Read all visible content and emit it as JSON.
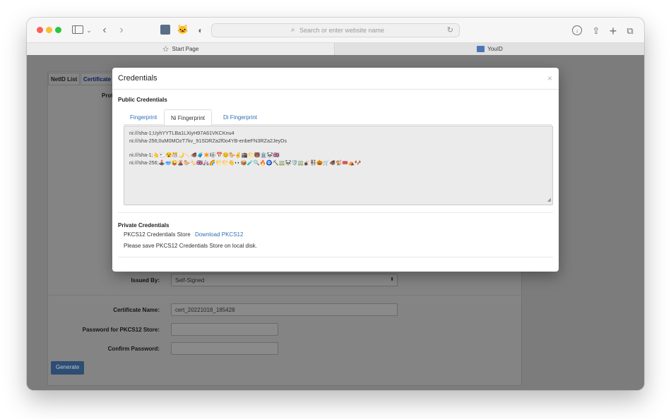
{
  "browser": {
    "url_placeholder": "Search or enter website name",
    "tabs": [
      {
        "label": "Start Page"
      },
      {
        "label": "YouID"
      }
    ]
  },
  "page": {
    "tabs": [
      {
        "label": "NetID List"
      },
      {
        "label": "Certificate"
      }
    ],
    "partial_label": "Prof",
    "form": {
      "issued_by_label": "Issued By:",
      "issued_by_value": "Self-Signed",
      "cert_name_label": "Certificate Name:",
      "cert_name_value": "cert_20221018_185428",
      "pkcs_password_label": "Password for PKCS12 Store:",
      "confirm_password_label": "Confirm Password:",
      "generate_label": "Generate"
    }
  },
  "modal": {
    "title": "Credentials",
    "close": "×",
    "public_title": "Public Credentials",
    "tabs": [
      {
        "label": "Fingerprint",
        "active": false
      },
      {
        "label": "Ni Fingerprint",
        "active": true
      },
      {
        "label": "Di Fingerprint",
        "active": false
      }
    ],
    "credentials": {
      "sha1": "ni:///sha-1;UyhYYTLBa1LXiyH97A61VKCKnu4",
      "sha256": "ni:///sha-256;0uM0MOzT7kv_91SDRZa2f0o4YB-enbeFN3RZa2JeyDs",
      "emoji_sha1": "ni:///sha-1;👆🐑😵🎊🌙🦴🐗🧳✴️🎼📅😊🐎✌️🕋🌕🐻🏛️🐼🇬🇧",
      "emoji_sha256": "ni:///sha-256;🕹️🥣😜🌋🐎🏷️🇬🇧🚑🌈🌕🌕👋👀📦🧪🔍🔥🧿⛏️🚃🐼🛡️🚃🎳👫🎃🛒🐗🐒🎟️⛺🐶"
    },
    "private_title": "Private Credentials",
    "pkcs_label": "PKCS12 Credentials Store",
    "pkcs_link": "Download PKCS12",
    "save_note": "Please save PKCS12 Credentials Store on local disk."
  }
}
